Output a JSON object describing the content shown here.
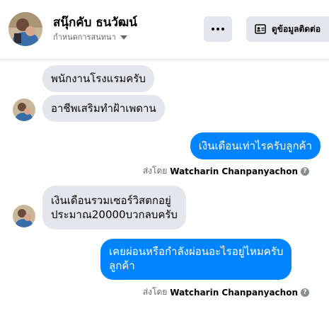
{
  "header": {
    "contact_name": "สนุ๊กคับ ธนวัฒน์",
    "status_text": "กำหนดการสนทนา",
    "more_icon": "more-horizontal-icon",
    "contact_button_icon": "contact-card-icon",
    "contact_button_label": "ดูข้อมูลติดต่อ"
  },
  "messages": [
    {
      "text": "พนักงานโรงแรมครับ"
    },
    {
      "text": "อาชีพเสริมทำฝ้าเพดาน"
    },
    {
      "text": "เงินเดือนเท่าไรครับลูกค้า"
    },
    {
      "line1": "เงินเดือนรวมเซอร์วิสตกอยู่",
      "line2": "ประมาณ20000บวกลบครับ"
    },
    {
      "line1": "เคยผ่อนหรือกำลังผ่อนอะไรอยู่ไหมครับ",
      "line2": "ลูกค้า"
    }
  ],
  "sent_by": {
    "prefix": "ส่งโดย",
    "name": "Watcharin Chanpanyachon",
    "help_symbol": "?"
  },
  "colors": {
    "outgoing_bubble": "#0084ff",
    "incoming_bubble": "#e4e6eb",
    "secondary_text": "#65676b"
  }
}
